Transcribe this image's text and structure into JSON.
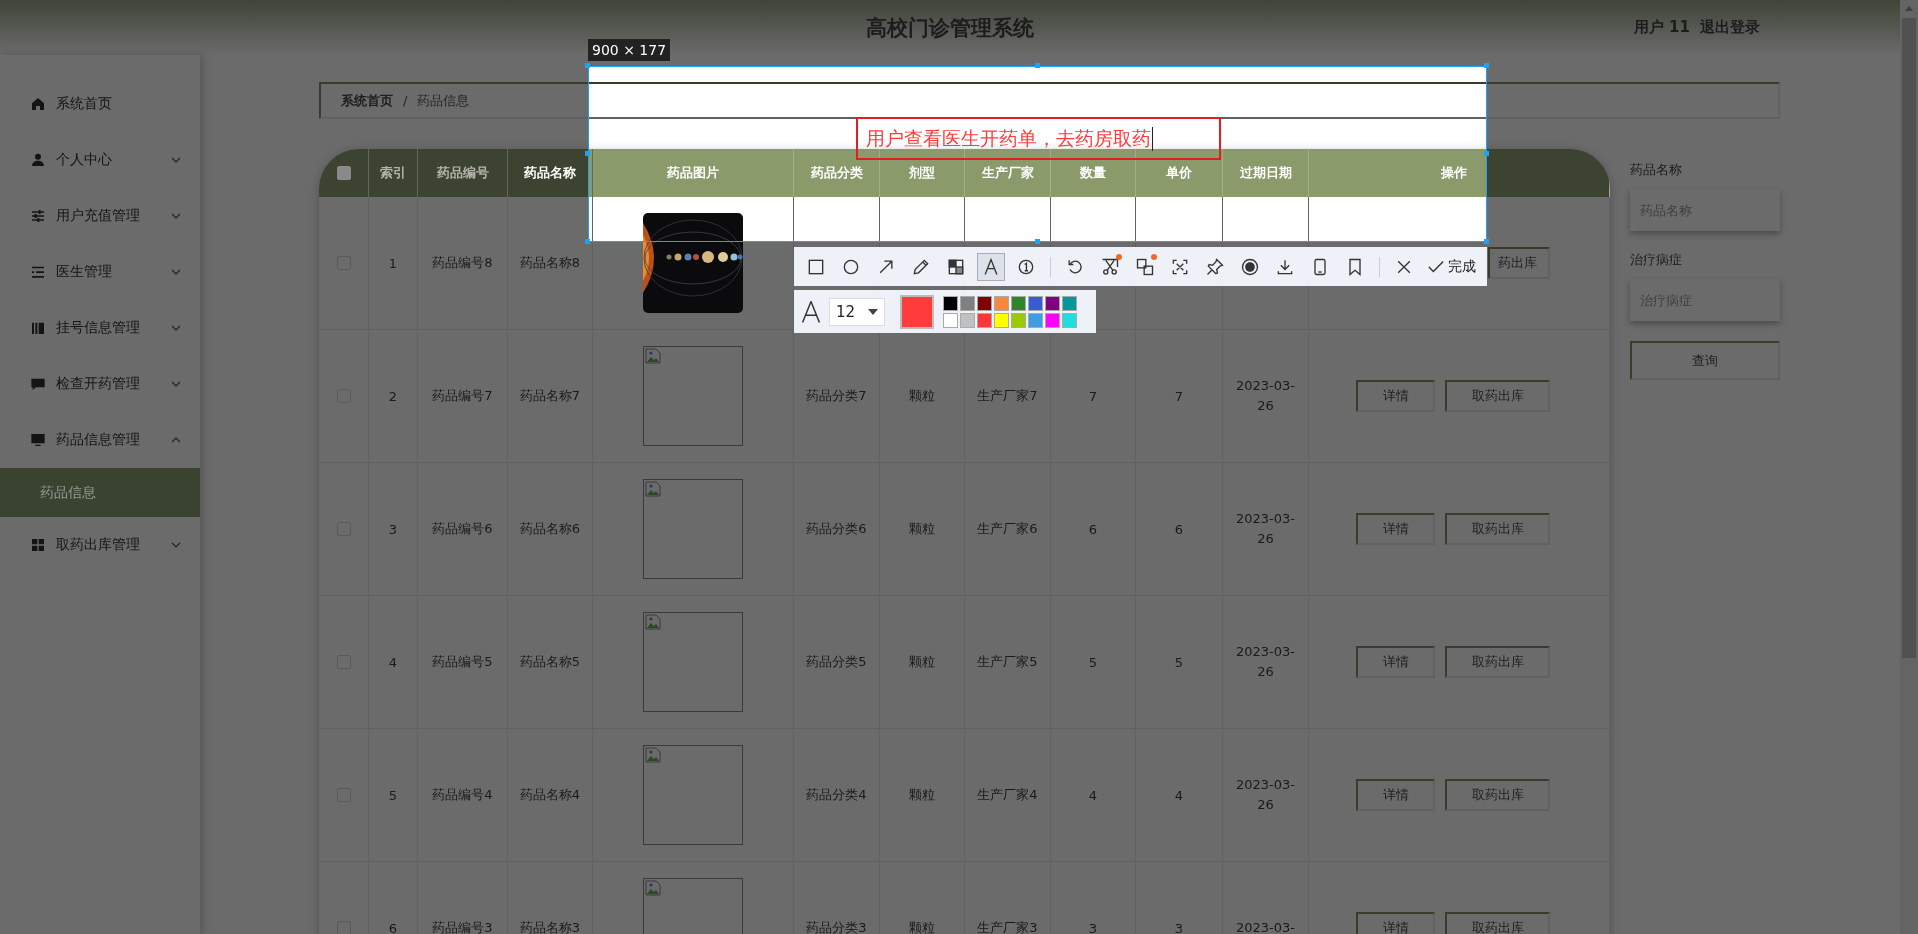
{
  "header": {
    "title": "高校门诊管理系统",
    "user": "用户 11",
    "logout": "退出登录"
  },
  "sidebar": {
    "items": [
      {
        "label": "系统首页",
        "kind": "link"
      },
      {
        "label": "个人中心",
        "kind": "menu",
        "expanded": false
      },
      {
        "label": "用户充值管理",
        "kind": "menu",
        "expanded": false
      },
      {
        "label": "医生管理",
        "kind": "menu",
        "expanded": false
      },
      {
        "label": "挂号信息管理",
        "kind": "menu",
        "expanded": false
      },
      {
        "label": "检查开药管理",
        "kind": "menu",
        "expanded": false
      },
      {
        "label": "药品信息管理",
        "kind": "menu",
        "expanded": true,
        "children": [
          {
            "label": "药品信息",
            "selected": true
          }
        ]
      },
      {
        "label": "取药出库管理",
        "kind": "menu",
        "expanded": false
      }
    ]
  },
  "breadcrumb": {
    "items": [
      "系统首页",
      "药品信息"
    ],
    "separator": "/"
  },
  "table": {
    "all_checked": false,
    "columns": [
      "索引",
      "药品编号",
      "药品名称",
      "药品图片",
      "药品分类",
      "剂型",
      "生产厂家",
      "数量",
      "单价",
      "过期日期",
      "操作"
    ],
    "rows": [
      {
        "checked": false,
        "index": "1",
        "code": "药品编号8",
        "name": "药品名称8",
        "image": {
          "kind": "picture"
        },
        "actions": [
          {
            "kind": "dispense",
            "label": "药出库"
          }
        ]
      },
      {
        "checked": false,
        "index": "2",
        "code": "药品编号7",
        "name": "药品名称7",
        "image": {
          "kind": "broken"
        },
        "category": "药品分类7",
        "form": "颗粒",
        "maker": "生产厂家7",
        "quantity": "7",
        "price": "7",
        "expiry": "2023-03-26",
        "actions": [
          {
            "kind": "details",
            "label": "详情"
          },
          {
            "kind": "dispense",
            "label": "取药出库"
          }
        ]
      },
      {
        "checked": false,
        "index": "3",
        "code": "药品编号6",
        "name": "药品名称6",
        "image": {
          "kind": "broken"
        },
        "category": "药品分类6",
        "form": "颗粒",
        "maker": "生产厂家6",
        "quantity": "6",
        "price": "6",
        "expiry": "2023-03-26",
        "actions": [
          {
            "kind": "details",
            "label": "详情"
          },
          {
            "kind": "dispense",
            "label": "取药出库"
          }
        ]
      },
      {
        "checked": false,
        "index": "4",
        "code": "药品编号5",
        "name": "药品名称5",
        "image": {
          "kind": "broken"
        },
        "category": "药品分类5",
        "form": "颗粒",
        "maker": "生产厂家5",
        "quantity": "5",
        "price": "5",
        "expiry": "2023-03-26",
        "actions": [
          {
            "kind": "details",
            "label": "详情"
          },
          {
            "kind": "dispense",
            "label": "取药出库"
          }
        ]
      },
      {
        "checked": false,
        "index": "5",
        "code": "药品编号4",
        "name": "药品名称4",
        "image": {
          "kind": "broken"
        },
        "category": "药品分类4",
        "form": "颗粒",
        "maker": "生产厂家4",
        "quantity": "4",
        "price": "4",
        "expiry": "2023-03-26",
        "actions": [
          {
            "kind": "details",
            "label": "详情"
          },
          {
            "kind": "dispense",
            "label": "取药出库"
          }
        ]
      },
      {
        "checked": false,
        "index": "6",
        "code": "药品编号3",
        "name": "药品名称3",
        "image": {
          "kind": "broken"
        },
        "category": "药品分类3",
        "form": "颗粒",
        "maker": "生产厂家3",
        "quantity": "3",
        "price": "3",
        "expiry": "2023-03-",
        "actions": [
          {
            "kind": "details",
            "label": "详情"
          },
          {
            "kind": "dispense",
            "label": "取药出库"
          }
        ]
      }
    ]
  },
  "search": {
    "fields": [
      {
        "label": "药品名称",
        "placeholder": "药品名称"
      },
      {
        "label": "治疗病症",
        "placeholder": "治疗病症"
      }
    ],
    "button": "查询"
  },
  "capture": {
    "size_label": "900 × 177",
    "annotation": "用户查看医生开药单，去药房取药",
    "tool_groups": [
      [
        {
          "kind": "rectangle",
          "selected": false
        },
        {
          "kind": "ellipse",
          "selected": false
        },
        {
          "kind": "arrow",
          "selected": false
        },
        {
          "kind": "pencil",
          "selected": false
        },
        {
          "kind": "mosaic",
          "selected": false
        },
        {
          "kind": "text",
          "selected": true
        },
        {
          "kind": "number",
          "selected": false
        }
      ],
      [
        {
          "kind": "undo",
          "selected": false
        },
        {
          "kind": "cut",
          "selected": false,
          "notify": true
        },
        {
          "kind": "translate",
          "selected": false,
          "notify": true
        },
        {
          "kind": "scan",
          "selected": false
        },
        {
          "kind": "pin",
          "selected": false
        },
        {
          "kind": "record",
          "selected": false
        },
        {
          "kind": "save",
          "selected": false
        },
        {
          "kind": "long",
          "selected": false
        },
        {
          "kind": "bookmark",
          "selected": false
        }
      ],
      [
        {
          "kind": "close",
          "selected": false
        },
        {
          "kind": "done",
          "selected": false,
          "label": "完成"
        }
      ]
    ],
    "font_size": "12",
    "current": {
      "color": "#ff3b3b"
    },
    "palette": [
      {
        "color": "#000000"
      },
      {
        "color": "#808080"
      },
      {
        "color": "#800000"
      },
      {
        "color": "#f7883a"
      },
      {
        "color": "#308430"
      },
      {
        "color": "#385ad3"
      },
      {
        "color": "#800080"
      },
      {
        "color": "#009999"
      },
      {
        "color": "#ffffff"
      },
      {
        "color": "#c0c0c0"
      },
      {
        "color": "#fb3838"
      },
      {
        "color": "#ffff00"
      },
      {
        "color": "#99cc00"
      },
      {
        "color": "#3d9ee0"
      },
      {
        "color": "#ff00ff"
      },
      {
        "color": "#22dddd"
      }
    ]
  }
}
